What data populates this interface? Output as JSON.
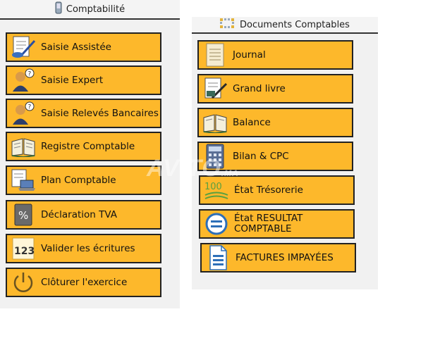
{
  "left_panel": {
    "title": "Comptabilité",
    "buttons": [
      {
        "label": "Saisie Assistée",
        "icon": "document-pen-icon"
      },
      {
        "label": "Saisie Expert",
        "icon": "person-question-icon"
      },
      {
        "label": "Saisie Relevés Bancaires",
        "icon": "person-question-icon"
      },
      {
        "label": "Registre Comptable",
        "icon": "open-book-icon"
      },
      {
        "label": "Plan Comptable",
        "icon": "document-laptop-icon"
      },
      {
        "label": "Déclaration TVA",
        "icon": "percent-icon"
      },
      {
        "label": "Valider les écritures",
        "icon": "numbers-123-icon"
      },
      {
        "label": "Clôturer l'exercice",
        "icon": "power-icon"
      }
    ]
  },
  "right_panel": {
    "title": "Documents Comptables",
    "buttons": [
      {
        "label": "Journal",
        "icon": "notepad-icon"
      },
      {
        "label": "Grand livre",
        "icon": "document-pen-icon"
      },
      {
        "label": "Balance",
        "icon": "open-book-icon"
      },
      {
        "label": "Bilan & CPC",
        "icon": "calculator-icon"
      },
      {
        "label": "État Trésorerie",
        "icon": "money-100-icon"
      },
      {
        "label": "État RESULTAT COMPTABLE",
        "icon": "equals-circle-icon"
      },
      {
        "label": "FACTURES IMPAYÉES",
        "icon": "document-lines-icon"
      }
    ]
  },
  "watermark": {
    "text": "AVITO",
    "suffix": ".MA"
  },
  "colors": {
    "button_bg": "#fdb82b",
    "panel_bg": "#f1f1f1",
    "border": "#222222"
  }
}
